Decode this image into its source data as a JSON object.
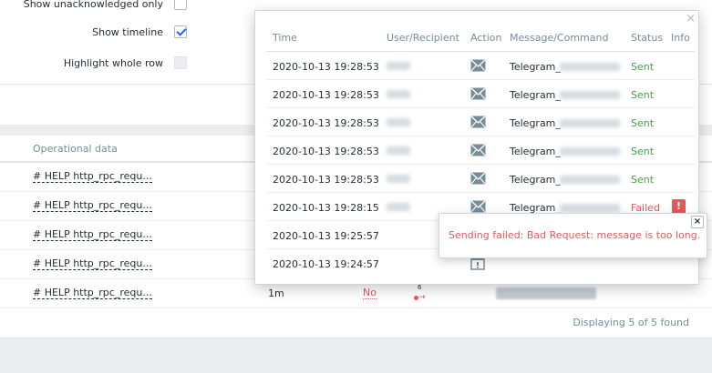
{
  "filters": {
    "show_unacknowledged_label": "Show unacknowledged only",
    "show_timeline_label": "Show timeline",
    "highlight_row_label": "Highlight whole row",
    "show_unacknowledged_checked": false,
    "show_timeline_checked": true,
    "highlight_row_disabled": true
  },
  "table": {
    "operational_data_header": "Operational data",
    "rows": [
      {
        "op": "# HELP http_rpc_requ...",
        "duration": "",
        "ack": ""
      },
      {
        "op": "# HELP http_rpc_requ...",
        "duration": "",
        "ack": ""
      },
      {
        "op": "# HELP http_rpc_requ...",
        "duration": "",
        "ack": ""
      },
      {
        "op": "# HELP http_rpc_requ...",
        "duration": "",
        "ack": ""
      },
      {
        "op": "# HELP http_rpc_requ...",
        "duration": "1m",
        "ack": "No",
        "actions_count": "6"
      }
    ],
    "footer": "Displaying 5 of 5 found"
  },
  "popup": {
    "close_glyph": "×",
    "headers": {
      "time": "Time",
      "recipient": "User/Recipient",
      "action": "Action",
      "message": "Message/Command",
      "status": "Status",
      "info": "Info"
    },
    "rows": [
      {
        "time": "2020-10-13 19:28:53",
        "action_icon": "envelope-icon",
        "message": "Telegram_",
        "status": "Sent",
        "status_type": "ok"
      },
      {
        "time": "2020-10-13 19:28:53",
        "action_icon": "envelope-icon",
        "message": "Telegram_",
        "status": "Sent",
        "status_type": "ok"
      },
      {
        "time": "2020-10-13 19:28:53",
        "action_icon": "envelope-icon",
        "message": "Telegram_",
        "status": "Sent",
        "status_type": "ok"
      },
      {
        "time": "2020-10-13 19:28:53",
        "action_icon": "envelope-icon",
        "message": "Telegram_",
        "status": "Sent",
        "status_type": "ok"
      },
      {
        "time": "2020-10-13 19:28:53",
        "action_icon": "envelope-icon",
        "message": "Telegram_",
        "status": "Sent",
        "status_type": "ok"
      },
      {
        "time": "2020-10-13 19:28:15",
        "action_icon": "envelope-icon",
        "message": "Telegram_",
        "status": "Failed",
        "status_type": "fail",
        "info": "!"
      },
      {
        "time": "2020-10-13 19:25:57",
        "action_icon": "",
        "message": "",
        "status": "",
        "status_type": ""
      },
      {
        "time": "2020-10-13 19:24:57",
        "action_icon": "calendar-icon",
        "message": "",
        "status": "",
        "status_type": ""
      }
    ]
  },
  "hint": {
    "text": "Sending failed: Bad Request: message is too long.",
    "close_glyph": "×"
  },
  "colors": {
    "ok": "#429e47",
    "fail": "#e45959",
    "muted": "#768d99",
    "accent": "#1f65f4"
  }
}
